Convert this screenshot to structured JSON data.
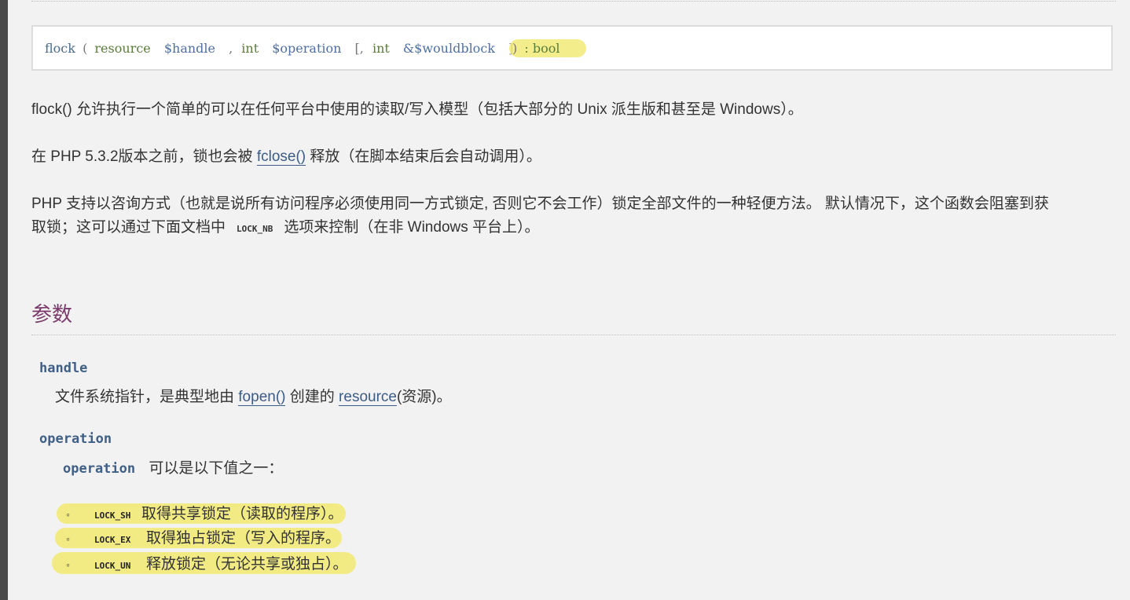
{
  "signature": {
    "func": "flock",
    "open_paren": "(",
    "type_resource": "resource",
    "var_handle": "$handle",
    "comma1": ",",
    "type_int1": "int",
    "var_operation": "$operation",
    "bracket_open": "[,",
    "type_int2": "int",
    "var_wouldblock": "&$wouldblock",
    "bracket_close": "]",
    "close_paren": ")",
    "return": ": bool"
  },
  "paragraphs": {
    "p1": "flock() 允许执行一个简单的可以在任何平台中使用的读取/写入模型（包括大部分的 Unix 派生版和甚至是 Windows）。",
    "p2_before": "在 PHP 5.3.2版本之前，锁也会被 ",
    "p2_link": "fclose()",
    "p2_after": " 释放（在脚本结束后会自动调用）。",
    "p3_line1": "PHP 支持以咨询方式（也就是说所有访问程序必须使用同一方式锁定, 否则它不会工作）锁定全部文件的一种轻便方法。 默认情况下，这个函数会阻塞到获",
    "p3_line2_before": "取锁；这可以通过下面文档中",
    "p3_code": "LOCK_NB",
    "p3_line2_after": "选项来控制（在非 Windows 平台上）。"
  },
  "section": {
    "title": "参数"
  },
  "params": {
    "handle": {
      "name": "handle",
      "desc_before": "文件系统指针，是典型地由 ",
      "link1": "fopen()",
      "desc_middle": " 创建的 ",
      "link2": "resource",
      "desc_after": "(资源)。"
    },
    "operation": {
      "name": "operation",
      "inner_name": "operation",
      "desc": "可以是以下值之一："
    }
  },
  "options": [
    {
      "bullet": "◦",
      "const": "LOCK_SH",
      "text": "取得共享锁定（读取的程序）。"
    },
    {
      "bullet": "◦",
      "const": "LOCK_EX",
      "text": "取得独占锁定（写入的程序。"
    },
    {
      "bullet": "◦",
      "const": "LOCK_UN",
      "text": "释放锁定（无论共享或独占）。"
    }
  ],
  "colors": {
    "highlight": "#f2ea78",
    "link": "#3b5b88",
    "section_title": "#7b3b6a",
    "param_name": "#3f5f86"
  }
}
